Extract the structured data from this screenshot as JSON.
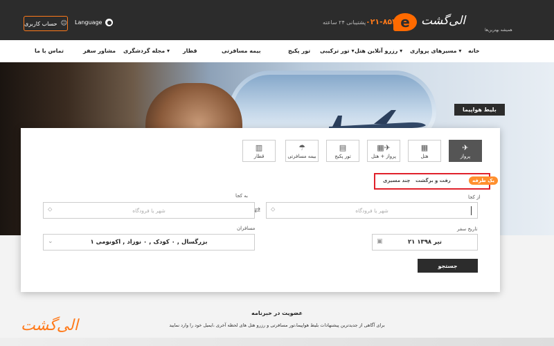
{
  "header": {
    "account_label": "حساب کاربری",
    "language_label": "Language",
    "support_text": "پشتیبانی ۲۴ ساعته",
    "phone": "۰۲۱-۸۵۴۰",
    "logo_text": "الی‌گشت",
    "logo_tagline": "همیشه بهترین‌ها"
  },
  "nav": {
    "items": [
      "خانه",
      "مسیرهای پروازی",
      "رزرو آنلاین هتل",
      "تور ترکیبی",
      "تور پکیج",
      "بیمه مسافرتی",
      "قطار",
      "مجله گردشگری",
      "مشاور سفر",
      "تماس با ما"
    ]
  },
  "hero": {
    "label": "بلیط هواپیما"
  },
  "search": {
    "tabs": [
      "پرواز",
      "هتل",
      "پرواز + هتل",
      "تور پکیج",
      "بیمه مسافرتی",
      "قطار"
    ],
    "trip_types": [
      "یک طرفه",
      "رفت و برگشت",
      "چند مسیری"
    ],
    "from_label": "از کجا",
    "to_label": "به کجا",
    "from_placeholder": "شهر یا فرودگاه",
    "to_placeholder": "شهر یا فرودگاه",
    "date_label": "تاریخ سفر",
    "date_value": "۲۱ تیر ۱۳۹۸",
    "passengers_label": "مسافران",
    "passengers_value": "۱ بزرگسال , ۰ کودک , ۰ نوزاد , اکونومی",
    "search_button": "جستجو"
  },
  "newsletter": {
    "title": "عضویت در خبرنامه",
    "description": "برای آگاهی از جدیدترین پیشنهادات بلیط هواپیما،تور مسافرتی و رزرو هتل های لحظه آخری ،ایمیل خود را وارد نمایید"
  },
  "footer": {
    "logo_text": "الی‌گشت"
  }
}
